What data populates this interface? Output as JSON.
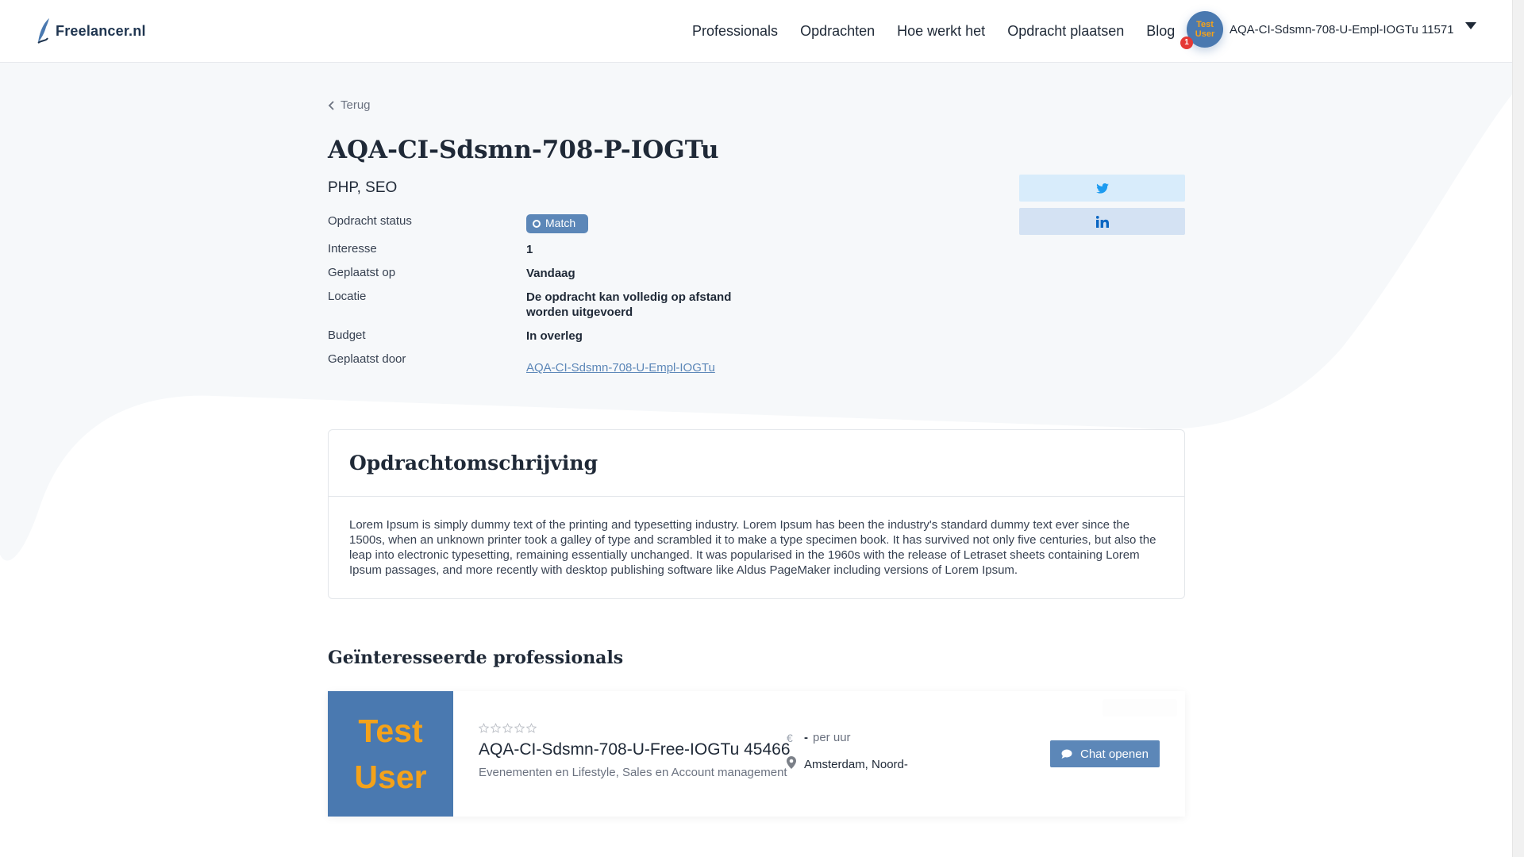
{
  "header": {
    "logo_text": "Freelancer.nl",
    "nav": [
      "Professionals",
      "Opdrachten",
      "Hoe werkt het",
      "Opdracht plaatsen",
      "Blog"
    ],
    "user": {
      "avatar_line1": "Test",
      "avatar_line2": "User",
      "notifications": "1",
      "name": "AQA-CI-Sdsmn-708-U-Empl-IOGTu 11571"
    }
  },
  "back_label": "Terug",
  "job": {
    "title": "AQA-CI-Sdsmn-708-P-IOGTu",
    "skills": "PHP, SEO",
    "details": {
      "status_label": "Opdracht status",
      "status_value": "Match",
      "interest_label": "Interesse",
      "interest_value": "1",
      "posted_label": "Geplaatst op",
      "posted_value": "Vandaag",
      "location_label": "Locatie",
      "location_value_line1": "De opdracht kan volledig op afstand",
      "location_value_line2": "worden uitgevoerd",
      "budget_label": "Budget",
      "budget_value": "In overleg",
      "posted_by_label": "Geplaatst door",
      "posted_by_value": "AQA-CI-Sdsmn-708-U-Empl-IOGTu"
    },
    "share": [
      "twitter-icon",
      "linkedin-icon"
    ]
  },
  "description": {
    "title": "Opdrachtomschrijving",
    "text": "Lorem Ipsum is simply dummy text of the printing and typesetting industry. Lorem Ipsum has been the industry's standard dummy text ever since the 1500s, when an unknown printer took a galley of type and scrambled it to make a type specimen book. It has survived not only five centuries, but also the leap into electronic typesetting, remaining essentially unchanged. It was popularised in the 1960s with the release of Letraset sheets containing Lorem Ipsum passages, and more recently with desktop publishing software like Aldus PageMaker including versions of Lorem Ipsum."
  },
  "interested": {
    "title": "Geïnteresseerde professionals",
    "professional": {
      "avatar_line1": "Test",
      "avatar_line2": "User",
      "rating": 0,
      "name": "AQA-CI-Sdsmn-708-U-Free-IOGTu 45466",
      "categories": "Evenementen en Lifestyle, Sales en Account management",
      "rate_symbol": "€",
      "rate_amount": "-",
      "rate_unit": "per uur",
      "location": "Amsterdam, Noord-",
      "chat_label": "Chat openen"
    }
  },
  "colors": {
    "accent": "#5c87b8",
    "avatar_bg": "#4a79b0",
    "avatar_text": "#f4a21a",
    "background_shape": "#f6f8fa"
  }
}
